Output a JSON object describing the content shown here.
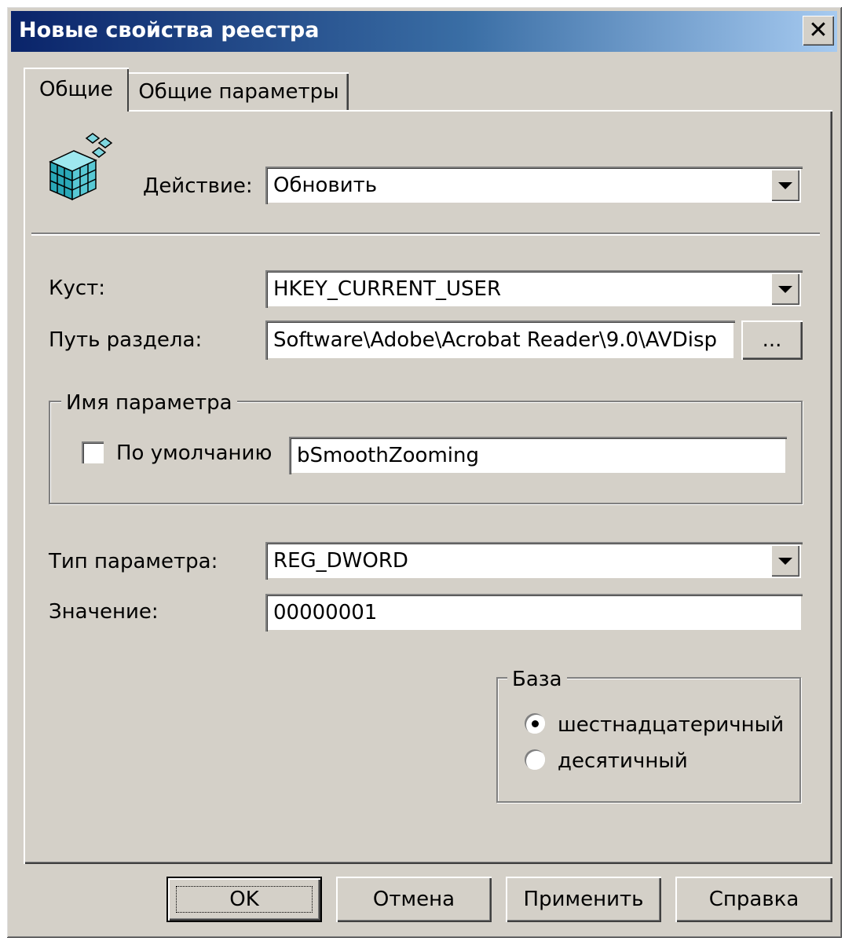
{
  "window": {
    "title": "Новые свойства реестра",
    "close_glyph": "✕"
  },
  "tabs": [
    {
      "label": "Общие",
      "active": true
    },
    {
      "label": "Общие параметры",
      "active": false
    }
  ],
  "general": {
    "icon": "registry-cubes-icon",
    "action_label": "Действие:",
    "action_value": "Обновить",
    "hive_label": "Куст:",
    "hive_value": "HKEY_CURRENT_USER",
    "key_path_label": "Путь раздела:",
    "key_path_value": "Software\\Adobe\\Acrobat Reader\\9.0\\AVDisp",
    "browse_label": "...",
    "value_name_group": "Имя параметра",
    "default_label": "По умолчанию",
    "default_checked": false,
    "value_name": "bSmoothZooming",
    "value_type_label": "Тип параметра:",
    "value_type": "REG_DWORD",
    "value_label": "Значение:",
    "value_data": "00000001",
    "base_group": "База",
    "base_options": [
      {
        "label": "шестнадцатеричный",
        "selected": true
      },
      {
        "label": "десятичный",
        "selected": false
      }
    ]
  },
  "buttons": {
    "ok": "OK",
    "cancel": "Отмена",
    "apply": "Применить",
    "help": "Справка"
  },
  "colors": {
    "face": "#d4d0c8",
    "title_start": "#0a246a",
    "title_end": "#a6caf0"
  }
}
